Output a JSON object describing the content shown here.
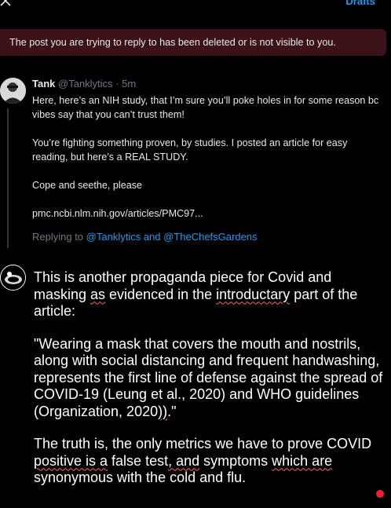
{
  "header": {
    "drafts_label": "Drafts"
  },
  "banner": {
    "text": "The post you are trying to reply to has been deleted or is not visible to you."
  },
  "post": {
    "name": "Tank",
    "handle": "@Tanklytics",
    "time": " · 5m",
    "paragraphs": [
      "Here, here’s an NIH study, that I’m sure you’ll poke holes in for some reason bc vibes say that you can’t trust them!",
      "You’re fighting something proven, by studies. I posted an article for easy reading, but here’s a REAL STUDY.",
      "Cope and seethe, please",
      "pmc.ncbi.nlm.nih.gov/articles/PMC97..."
    ]
  },
  "replying": {
    "prefix": "Replying to ",
    "mentions": "@Tanklytics and @TheChefsGardens"
  },
  "reply": {
    "p1": {
      "a": "This is another propaganda piece for Covid and masking ",
      "b": "as",
      "c": " evidenced in the ",
      "d": "introductary",
      "e": " part of the article:"
    },
    "p2": {
      "a": "\"Wearing a mask that covers the mouth and nostrils, along with social distancing and frequent handwashing, represents the first line of defense against the spread of COVID-19 (Leung et al., 2020) and WHO guidelines (Organization, 2020",
      "b": "))",
      "c": ".\""
    },
    "p3": {
      "a": "The truth is, the only metrics we have to prove COVID ",
      "b": "positive is a",
      "c": " false test",
      "d": ", and",
      "e": " symptoms ",
      "f": "which are",
      "g": " synonymous with the cold and flu."
    }
  },
  "icons": {
    "close": "close-icon",
    "status_dot_color": "#f4212e"
  }
}
